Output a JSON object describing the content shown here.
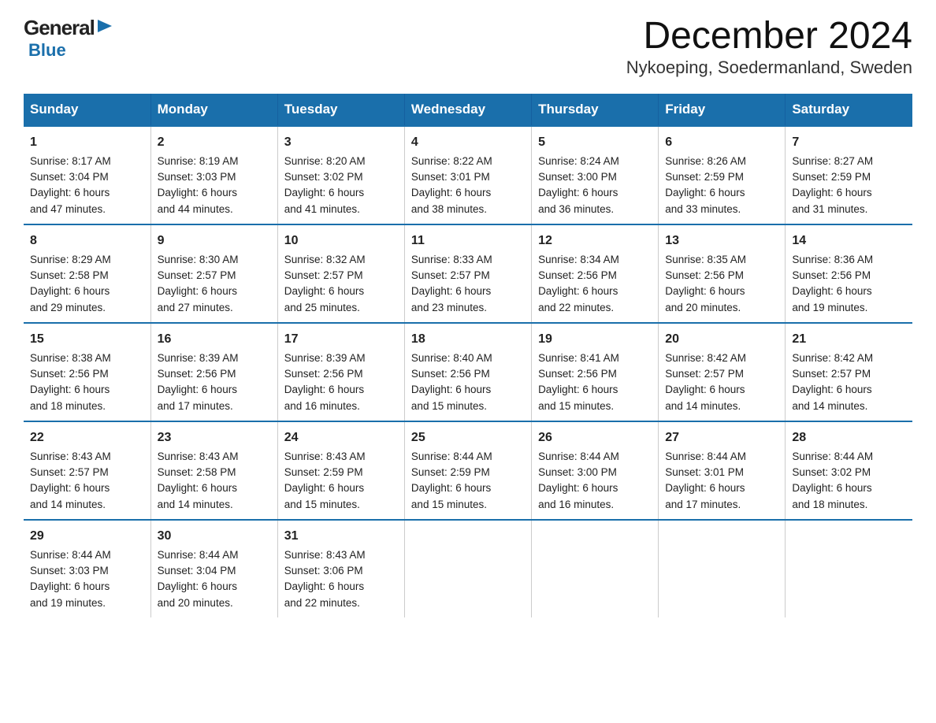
{
  "header": {
    "title": "December 2024",
    "subtitle": "Nykoeping, Soedermanland, Sweden",
    "logo_general": "General",
    "logo_blue": "Blue"
  },
  "weekdays": [
    "Sunday",
    "Monday",
    "Tuesday",
    "Wednesday",
    "Thursday",
    "Friday",
    "Saturday"
  ],
  "weeks": [
    [
      {
        "day": 1,
        "lines": [
          "Sunrise: 8:17 AM",
          "Sunset: 3:04 PM",
          "Daylight: 6 hours",
          "and 47 minutes."
        ]
      },
      {
        "day": 2,
        "lines": [
          "Sunrise: 8:19 AM",
          "Sunset: 3:03 PM",
          "Daylight: 6 hours",
          "and 44 minutes."
        ]
      },
      {
        "day": 3,
        "lines": [
          "Sunrise: 8:20 AM",
          "Sunset: 3:02 PM",
          "Daylight: 6 hours",
          "and 41 minutes."
        ]
      },
      {
        "day": 4,
        "lines": [
          "Sunrise: 8:22 AM",
          "Sunset: 3:01 PM",
          "Daylight: 6 hours",
          "and 38 minutes."
        ]
      },
      {
        "day": 5,
        "lines": [
          "Sunrise: 8:24 AM",
          "Sunset: 3:00 PM",
          "Daylight: 6 hours",
          "and 36 minutes."
        ]
      },
      {
        "day": 6,
        "lines": [
          "Sunrise: 8:26 AM",
          "Sunset: 2:59 PM",
          "Daylight: 6 hours",
          "and 33 minutes."
        ]
      },
      {
        "day": 7,
        "lines": [
          "Sunrise: 8:27 AM",
          "Sunset: 2:59 PM",
          "Daylight: 6 hours",
          "and 31 minutes."
        ]
      }
    ],
    [
      {
        "day": 8,
        "lines": [
          "Sunrise: 8:29 AM",
          "Sunset: 2:58 PM",
          "Daylight: 6 hours",
          "and 29 minutes."
        ]
      },
      {
        "day": 9,
        "lines": [
          "Sunrise: 8:30 AM",
          "Sunset: 2:57 PM",
          "Daylight: 6 hours",
          "and 27 minutes."
        ]
      },
      {
        "day": 10,
        "lines": [
          "Sunrise: 8:32 AM",
          "Sunset: 2:57 PM",
          "Daylight: 6 hours",
          "and 25 minutes."
        ]
      },
      {
        "day": 11,
        "lines": [
          "Sunrise: 8:33 AM",
          "Sunset: 2:57 PM",
          "Daylight: 6 hours",
          "and 23 minutes."
        ]
      },
      {
        "day": 12,
        "lines": [
          "Sunrise: 8:34 AM",
          "Sunset: 2:56 PM",
          "Daylight: 6 hours",
          "and 22 minutes."
        ]
      },
      {
        "day": 13,
        "lines": [
          "Sunrise: 8:35 AM",
          "Sunset: 2:56 PM",
          "Daylight: 6 hours",
          "and 20 minutes."
        ]
      },
      {
        "day": 14,
        "lines": [
          "Sunrise: 8:36 AM",
          "Sunset: 2:56 PM",
          "Daylight: 6 hours",
          "and 19 minutes."
        ]
      }
    ],
    [
      {
        "day": 15,
        "lines": [
          "Sunrise: 8:38 AM",
          "Sunset: 2:56 PM",
          "Daylight: 6 hours",
          "and 18 minutes."
        ]
      },
      {
        "day": 16,
        "lines": [
          "Sunrise: 8:39 AM",
          "Sunset: 2:56 PM",
          "Daylight: 6 hours",
          "and 17 minutes."
        ]
      },
      {
        "day": 17,
        "lines": [
          "Sunrise: 8:39 AM",
          "Sunset: 2:56 PM",
          "Daylight: 6 hours",
          "and 16 minutes."
        ]
      },
      {
        "day": 18,
        "lines": [
          "Sunrise: 8:40 AM",
          "Sunset: 2:56 PM",
          "Daylight: 6 hours",
          "and 15 minutes."
        ]
      },
      {
        "day": 19,
        "lines": [
          "Sunrise: 8:41 AM",
          "Sunset: 2:56 PM",
          "Daylight: 6 hours",
          "and 15 minutes."
        ]
      },
      {
        "day": 20,
        "lines": [
          "Sunrise: 8:42 AM",
          "Sunset: 2:57 PM",
          "Daylight: 6 hours",
          "and 14 minutes."
        ]
      },
      {
        "day": 21,
        "lines": [
          "Sunrise: 8:42 AM",
          "Sunset: 2:57 PM",
          "Daylight: 6 hours",
          "and 14 minutes."
        ]
      }
    ],
    [
      {
        "day": 22,
        "lines": [
          "Sunrise: 8:43 AM",
          "Sunset: 2:57 PM",
          "Daylight: 6 hours",
          "and 14 minutes."
        ]
      },
      {
        "day": 23,
        "lines": [
          "Sunrise: 8:43 AM",
          "Sunset: 2:58 PM",
          "Daylight: 6 hours",
          "and 14 minutes."
        ]
      },
      {
        "day": 24,
        "lines": [
          "Sunrise: 8:43 AM",
          "Sunset: 2:59 PM",
          "Daylight: 6 hours",
          "and 15 minutes."
        ]
      },
      {
        "day": 25,
        "lines": [
          "Sunrise: 8:44 AM",
          "Sunset: 2:59 PM",
          "Daylight: 6 hours",
          "and 15 minutes."
        ]
      },
      {
        "day": 26,
        "lines": [
          "Sunrise: 8:44 AM",
          "Sunset: 3:00 PM",
          "Daylight: 6 hours",
          "and 16 minutes."
        ]
      },
      {
        "day": 27,
        "lines": [
          "Sunrise: 8:44 AM",
          "Sunset: 3:01 PM",
          "Daylight: 6 hours",
          "and 17 minutes."
        ]
      },
      {
        "day": 28,
        "lines": [
          "Sunrise: 8:44 AM",
          "Sunset: 3:02 PM",
          "Daylight: 6 hours",
          "and 18 minutes."
        ]
      }
    ],
    [
      {
        "day": 29,
        "lines": [
          "Sunrise: 8:44 AM",
          "Sunset: 3:03 PM",
          "Daylight: 6 hours",
          "and 19 minutes."
        ]
      },
      {
        "day": 30,
        "lines": [
          "Sunrise: 8:44 AM",
          "Sunset: 3:04 PM",
          "Daylight: 6 hours",
          "and 20 minutes."
        ]
      },
      {
        "day": 31,
        "lines": [
          "Sunrise: 8:43 AM",
          "Sunset: 3:06 PM",
          "Daylight: 6 hours",
          "and 22 minutes."
        ]
      },
      null,
      null,
      null,
      null
    ]
  ]
}
